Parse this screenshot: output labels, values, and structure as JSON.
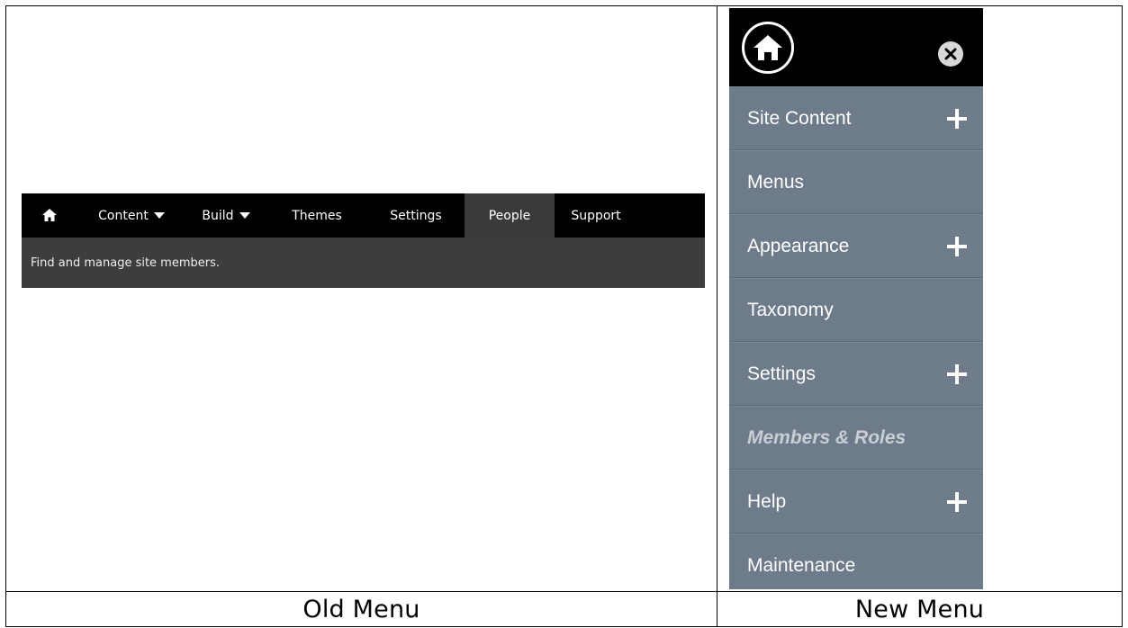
{
  "old_menu": {
    "nav_items": [
      {
        "label": "Content",
        "has_dropdown": true
      },
      {
        "label": "Build",
        "has_dropdown": true
      },
      {
        "label": "Themes"
      },
      {
        "label": "Settings"
      },
      {
        "label": "People",
        "active": true
      },
      {
        "label": "Support"
      }
    ],
    "description": "Find and manage site members.",
    "caption": "Old Menu"
  },
  "new_menu": {
    "items": [
      {
        "label": "Site Content",
        "expandable": true
      },
      {
        "label": "Menus"
      },
      {
        "label": "Appearance",
        "expandable": true
      },
      {
        "label": "Taxonomy"
      },
      {
        "label": "Settings",
        "expandable": true
      },
      {
        "label": "Members & Roles",
        "current": true
      },
      {
        "label": "Help",
        "expandable": true
      },
      {
        "label": "Maintenance"
      }
    ],
    "caption": "New Menu"
  },
  "icons": {
    "home": "home-icon",
    "close": "close-icon",
    "expand": "plus-icon",
    "dropdown": "caret-down-icon"
  },
  "colors": {
    "old_bar": "#000000",
    "old_active": "#3a3a3a",
    "old_sub": "#3d3d3d",
    "new_top": "#000000",
    "new_item": "#6d7b8b",
    "new_current_text": "#c9ced4"
  }
}
